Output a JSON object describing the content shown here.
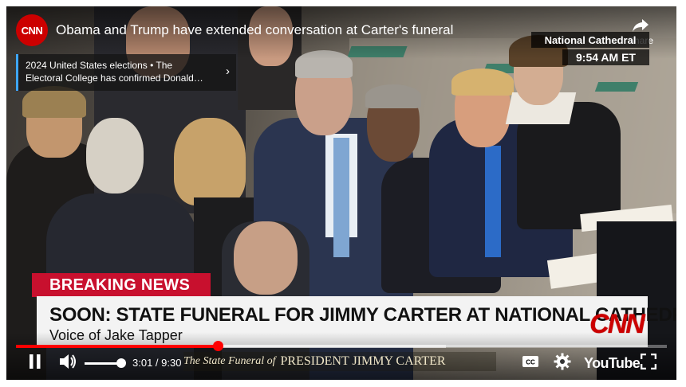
{
  "player": {
    "channel_logo": "CNN",
    "title": "Obama and Trump have extended conversation at Carter's funeral",
    "share_label": "Share",
    "info_card": {
      "line1": "2024 United States elections • The",
      "line2": "Electoral College has confirmed Donald…"
    },
    "controls": {
      "time": "3:01 / 9:30",
      "brand": "YouTube",
      "progress_fraction": 0.31,
      "buffer_fraction": 0.66,
      "volume_fraction": 0.85
    }
  },
  "broadcast": {
    "location": "National Cathedral",
    "clock": "9:54 AM ET",
    "breaking_label": "BREAKING NEWS",
    "headline": "SOON: STATE FUNERAL FOR JIMMY CARTER AT NATIONAL CATHEDRAL",
    "subline": "Voice of Jake Tapper",
    "network_bug": "CNN",
    "ribbon_prefix": "The State Funeral of",
    "ribbon_main": "PRESIDENT JIMMY CARTER"
  },
  "colors": {
    "youtube_red": "#ff0000",
    "cnn_red": "#cc0000",
    "breaking_red": "#c8102e"
  },
  "icons": [
    "share-icon",
    "chevron-right-icon",
    "pause-icon",
    "volume-icon",
    "closed-captions-icon",
    "gear-icon",
    "fullscreen-icon"
  ]
}
